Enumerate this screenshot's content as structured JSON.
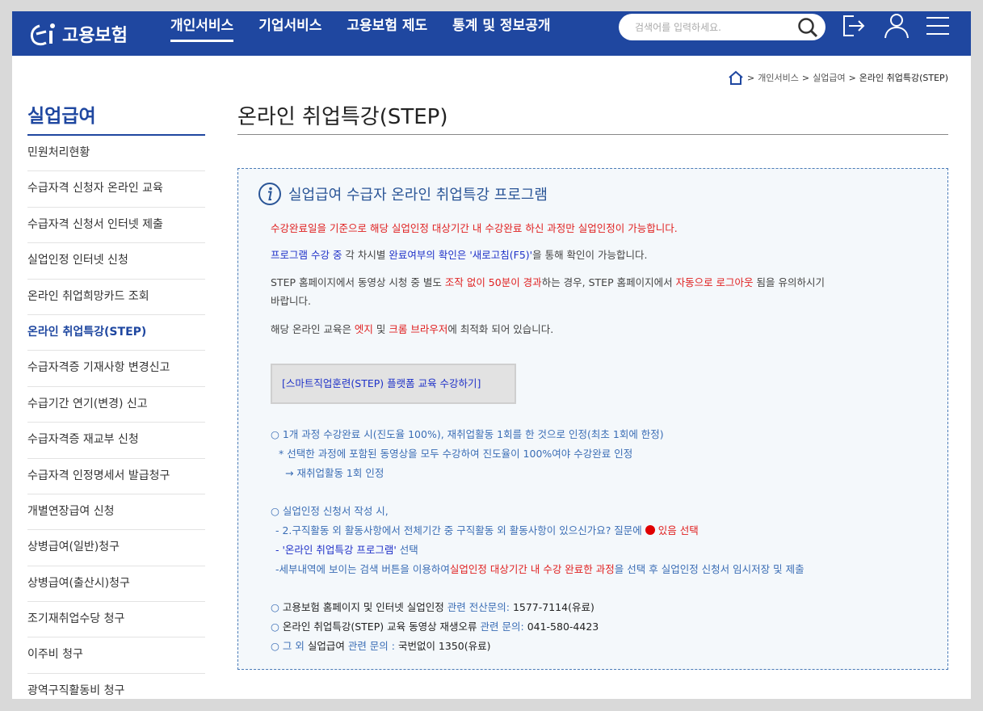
{
  "header": {
    "logo_text": "고용보험",
    "nav": [
      "개인서비스",
      "기업서비스",
      "고용보험 제도",
      "통계 및 정보공개"
    ],
    "search_placeholder": "검색어를 입력하세요.",
    "icons": [
      "search-icon",
      "logout-icon",
      "user-icon",
      "menu-icon"
    ],
    "brand_color": "#1f47a0"
  },
  "breadcrumb": {
    "home_icon": "home-icon",
    "items": [
      "개인서비스",
      "실업급여",
      "온라인 취업특강(STEP)"
    ]
  },
  "sidebar": {
    "title": "실업급여",
    "items": [
      "민원처리현황",
      "수급자격 신청자 온라인 교육",
      "수급자격 신청서 인터넷 제출",
      "실업인정 인터넷 신청",
      "온라인 취업희망카드 조회",
      "온라인 취업특강(STEP)",
      "수급자격증 기재사항 변경신고",
      "수급기간 연기(변경) 신고",
      "수급자격증 재교부 신청",
      "수급자격 인정명세서 발급청구",
      "개별연장급여 신청",
      "상병급여(일반)청구",
      "상병급여(출산시)청구",
      "조기재취업수당 청구",
      "이주비 청구",
      "광역구직활동비 청구"
    ],
    "active_index": 5
  },
  "main": {
    "title": "온라인 취업특강(STEP)",
    "box_title": "실업급여 수급자 온라인 취업특강 프로그램",
    "p1": "수강완료일을 기준으로 해당 실업인정 대상기간 내 수강완료 하신 과정만 실업인정이 가능합니다.",
    "p2": {
      "a": "프로그램 수강 중",
      "b": " 각 차시별 ",
      "c": "완료여부의 확인은 '새로고침(F5)'",
      "d": "을 통해 확인이 가능합니다."
    },
    "p3": {
      "a": "STEP 홈페이지에서 동영상 시청 중 별도 ",
      "b": "조작 없이 50분이 경과",
      "c": "하는 경우, STEP 홈페이지에서 ",
      "d": "자동으로 로그아웃",
      "e": " 됨을 유의하시기",
      "f": "바랍니다."
    },
    "p4": {
      "a": "해당 온라인 교육은 ",
      "b": "엣지",
      "c": " 및 ",
      "d": "크롬 브라우저",
      "e": "에 최적화 되어 있습니다."
    },
    "button_label": "[스마트직업훈련(STEP) 플랫폼 교육 수강하기]",
    "s1": {
      "l1": "○ 1개 과정 수강완료 시(진도율 100%), 재취업활동 1회를 한 것으로 인정(최초 1회에 한정)",
      "l2": "* 선택한 과정에 포함된 동영상을 모두 수강하여 진도율이 100%여야 수강완료 인정",
      "l3": "→ 재취업활동 1회 인정"
    },
    "s2": {
      "l1": "○ 실업인정 신청서 작성 시,",
      "l2a": "- 2.구직활동 외 활동사항에서 전체기간 중 구직활동 외 활동사항이 있으신가요? 질문에 ",
      "l2b": " 있음 선택",
      "l3a": "- '온라인 취업특강 프로그램'",
      "l3b": " 선택",
      "l4a": "-세부내역에 보이는 검색 버튼을 이용하여",
      "l4b": "실업인정 대상기간 내 수강 완료한 과정",
      "l4c": "을 선택 후 실업인정 신청서 임시저장 및 제출"
    },
    "s3": {
      "l1a": "○ ",
      "l1b": "고용보험 홈페이지 및 인터넷 실업인정",
      "l1c": " 관련 전산문의: ",
      "l1d": "1577-7114(유료)",
      "l2a": "○ ",
      "l2b": "온라인 취업특강(STEP) 교육 동영상 재생오류",
      "l2c": " 관련 문의: ",
      "l2d": "041-580-4423",
      "l3a": "○ 그 외 ",
      "l3b": "실업급여",
      "l3c": " 관련 문의 : ",
      "l3d": "국번없이 1350(유료)"
    }
  }
}
